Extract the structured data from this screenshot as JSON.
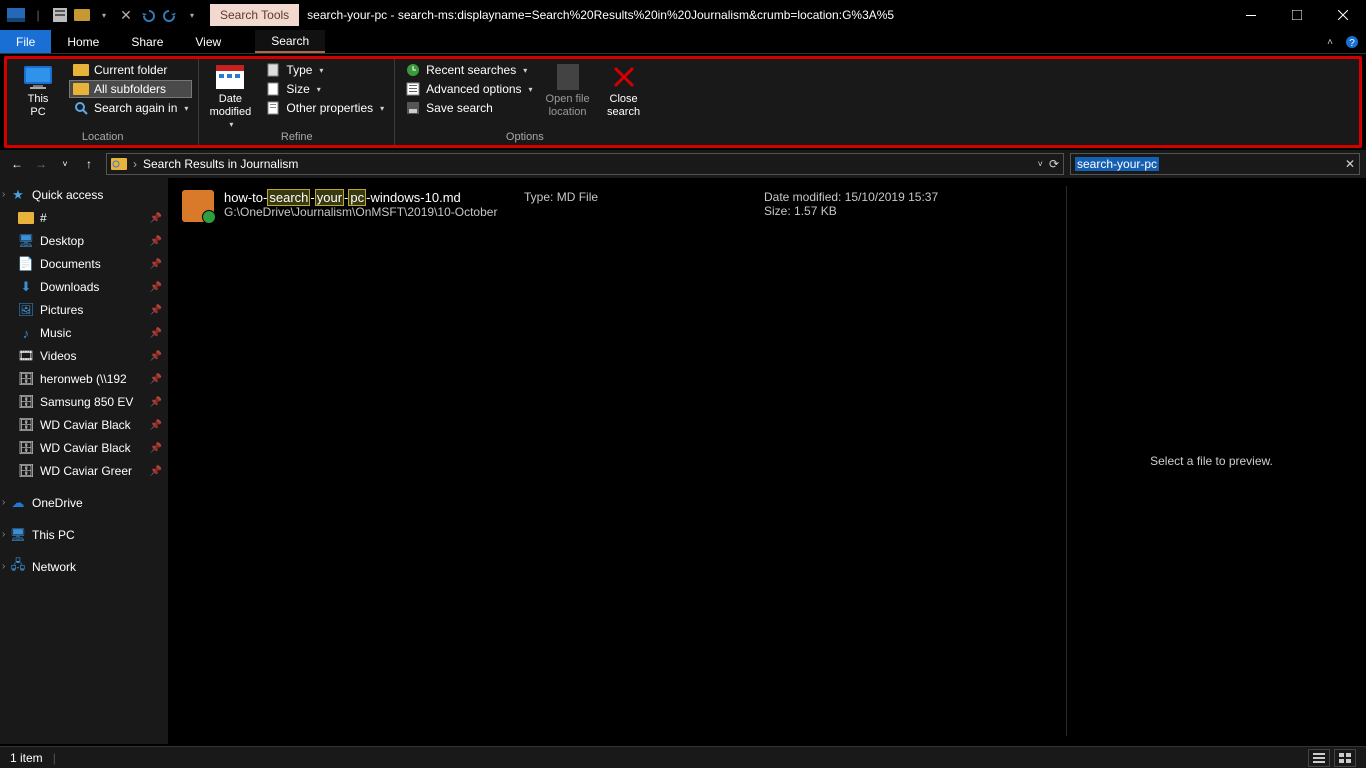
{
  "titlebar": {
    "contextual_tab": "Search Tools",
    "title": "search-your-pc - search-ms:displayname=Search%20Results%20in%20Journalism&crumb=location:G%3A%5"
  },
  "tabs": {
    "file": "File",
    "home": "Home",
    "share": "Share",
    "view": "View",
    "search": "Search"
  },
  "ribbon": {
    "location": {
      "label": "Location",
      "this_pc": "This\nPC",
      "current_folder": "Current folder",
      "all_subfolders": "All subfolders",
      "search_again_in": "Search again in"
    },
    "refine": {
      "label": "Refine",
      "date_modified": "Date\nmodified",
      "type": "Type",
      "size": "Size",
      "other_properties": "Other properties"
    },
    "options": {
      "label": "Options",
      "recent_searches": "Recent searches",
      "advanced_options": "Advanced options",
      "save_search": "Save search",
      "open_file_location": "Open file\nlocation",
      "close_search": "Close\nsearch"
    }
  },
  "address": {
    "crumb_sep": "›",
    "crumb": "Search Results in Journalism"
  },
  "search": {
    "query": "search-your-pc"
  },
  "sidebar": {
    "quick_access": "Quick access",
    "items": [
      {
        "label": "#",
        "icon": "folder"
      },
      {
        "label": "Desktop",
        "icon": "desktop"
      },
      {
        "label": "Documents",
        "icon": "documents"
      },
      {
        "label": "Downloads",
        "icon": "downloads"
      },
      {
        "label": "Pictures",
        "icon": "pictures"
      },
      {
        "label": "Music",
        "icon": "music"
      },
      {
        "label": "Videos",
        "icon": "videos"
      },
      {
        "label": "heronweb (\\\\192",
        "icon": "netdrive"
      },
      {
        "label": "Samsung 850 EV",
        "icon": "drive"
      },
      {
        "label": "WD Caviar Black",
        "icon": "drive"
      },
      {
        "label": "WD Caviar Black",
        "icon": "drive"
      },
      {
        "label": "WD Caviar Greer",
        "icon": "drive"
      }
    ],
    "onedrive": "OneDrive",
    "this_pc": "This PC",
    "network": "Network"
  },
  "result": {
    "title_pre": "how-to-",
    "title_hl1": "search",
    "title_mid1": "-",
    "title_hl2": "your",
    "title_mid2": "-",
    "title_hl3": "pc",
    "title_post": "-windows-10.md",
    "path": "G:\\OneDrive\\Journalism\\OnMSFT\\2019\\10-October",
    "type_label": "Type:",
    "type_value": "MD File",
    "date_label": "Date modified:",
    "date_value": "15/10/2019 15:37",
    "size_label": "Size:",
    "size_value": "1.57 KB"
  },
  "preview": {
    "placeholder": "Select a file to preview."
  },
  "status": {
    "count": "1 item"
  }
}
